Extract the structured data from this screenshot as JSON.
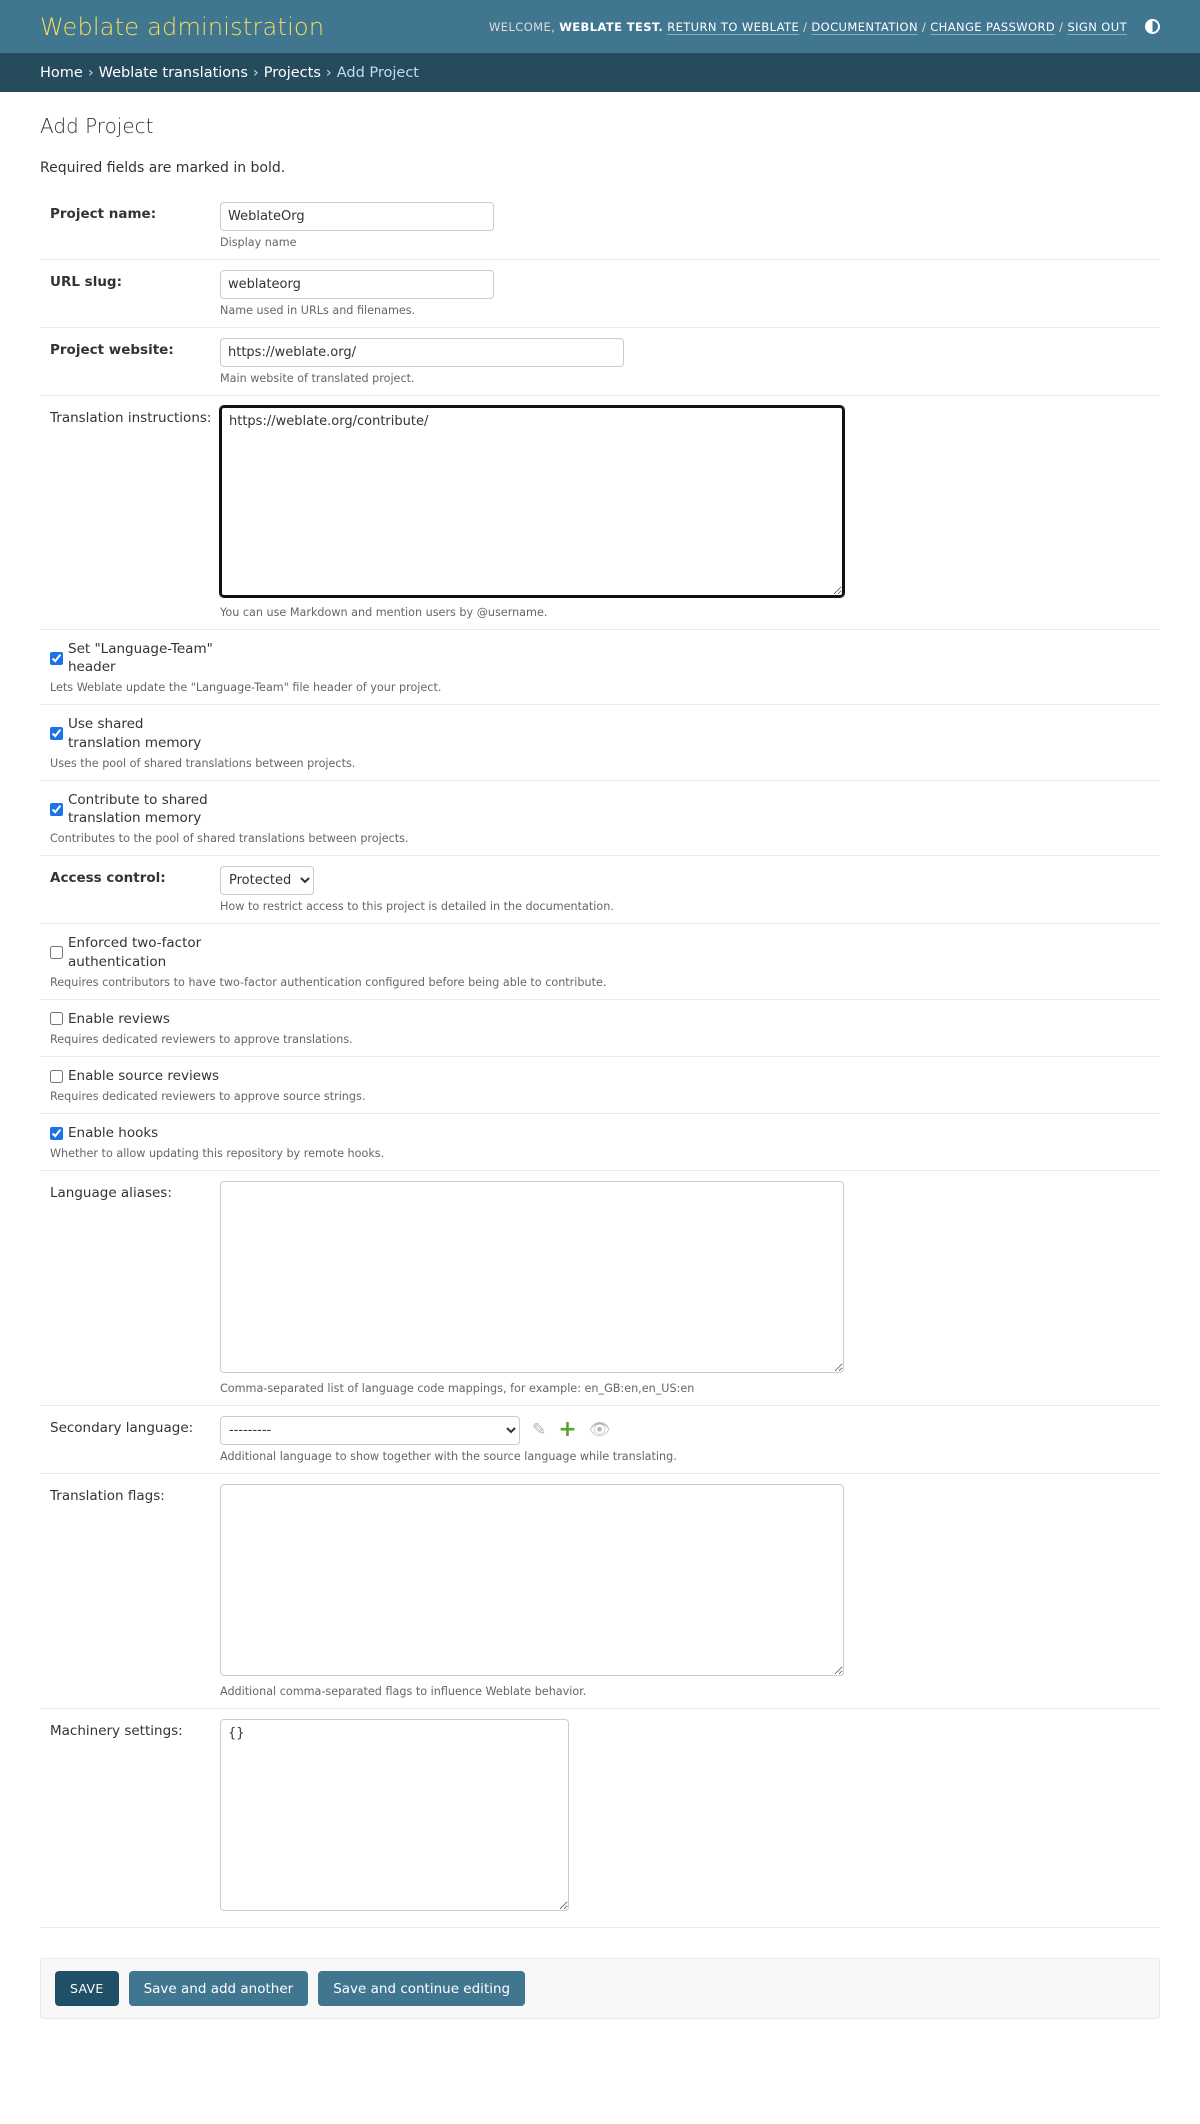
{
  "header": {
    "branding": "Weblate administration",
    "welcome": "WELCOME,",
    "username": "WEBLATE TEST.",
    "links": [
      "RETURN TO WEBLATE",
      "DOCUMENTATION",
      "CHANGE PASSWORD",
      "SIGN OUT"
    ],
    "separator": "/",
    "theme_icon": "half-circle-contrast-icon"
  },
  "breadcrumbs": {
    "items": [
      "Home",
      "Weblate translations",
      "Projects"
    ],
    "current": "Add Project",
    "arrow": "›"
  },
  "page": {
    "title": "Add Project",
    "note": "Required fields are marked in bold."
  },
  "form": {
    "name": {
      "label": "Project name:",
      "value": "WeblateOrg",
      "help": "Display name"
    },
    "slug": {
      "label": "URL slug:",
      "value": "weblateorg",
      "help": "Name used in URLs and filenames."
    },
    "web": {
      "label": "Project website:",
      "value": "https://weblate.org/",
      "help": "Main website of translated project."
    },
    "instructions": {
      "label": "Translation instructions:",
      "value": "https://weblate.org/contribute/",
      "help": "You can use Markdown and mention users by @username."
    },
    "set_language_team": {
      "label": "Set \"Language-Team\" header",
      "checked": true,
      "help": "Lets Weblate update the \"Language-Team\" file header of your project."
    },
    "use_shared_tm": {
      "label": "Use shared translation memory",
      "checked": true,
      "help": "Uses the pool of shared translations between projects."
    },
    "contribute_shared_tm": {
      "label": "Contribute to shared translation memory",
      "checked": true,
      "help": "Contributes to the pool of shared translations between projects."
    },
    "access_control": {
      "label": "Access control:",
      "value": "Protected",
      "help": "How to restrict access to this project is detailed in the documentation."
    },
    "enforced_2fa": {
      "label": "Enforced two-factor authentication",
      "checked": false,
      "help": "Requires contributors to have two-factor authentication configured before being able to contribute."
    },
    "enable_review": {
      "label": "Enable reviews",
      "checked": false,
      "help": "Requires dedicated reviewers to approve translations."
    },
    "source_review": {
      "label": "Enable source reviews",
      "checked": false,
      "help": "Requires dedicated reviewers to approve source strings."
    },
    "enable_hooks": {
      "label": "Enable hooks",
      "checked": true,
      "help": "Whether to allow updating this repository by remote hooks."
    },
    "language_aliases": {
      "label": "Language aliases:",
      "value": "",
      "help": "Comma-separated list of language code mappings, for example: en_GB:en,en_US:en"
    },
    "secondary_language": {
      "label": "Secondary language:",
      "value": "---------",
      "help": "Additional language to show together with the source language while translating.",
      "icons": [
        "pencil-icon",
        "plus-icon",
        "eye-icon"
      ]
    },
    "check_flags": {
      "label": "Translation flags:",
      "value": "",
      "help": "Additional comma-separated flags to influence Weblate behavior."
    },
    "machinery_settings": {
      "label": "Machinery settings:",
      "value": "{}"
    }
  },
  "buttons": {
    "save": "SAVE",
    "save_add_another": "Save and add another",
    "save_continue": "Save and continue editing"
  },
  "colors": {
    "header_bg": "#417690",
    "breadcrumbs_bg": "#264b5d",
    "branding": "#f5dd5d",
    "button": "#417690",
    "default_button": "#205067",
    "add_icon": "#5aa02c"
  }
}
